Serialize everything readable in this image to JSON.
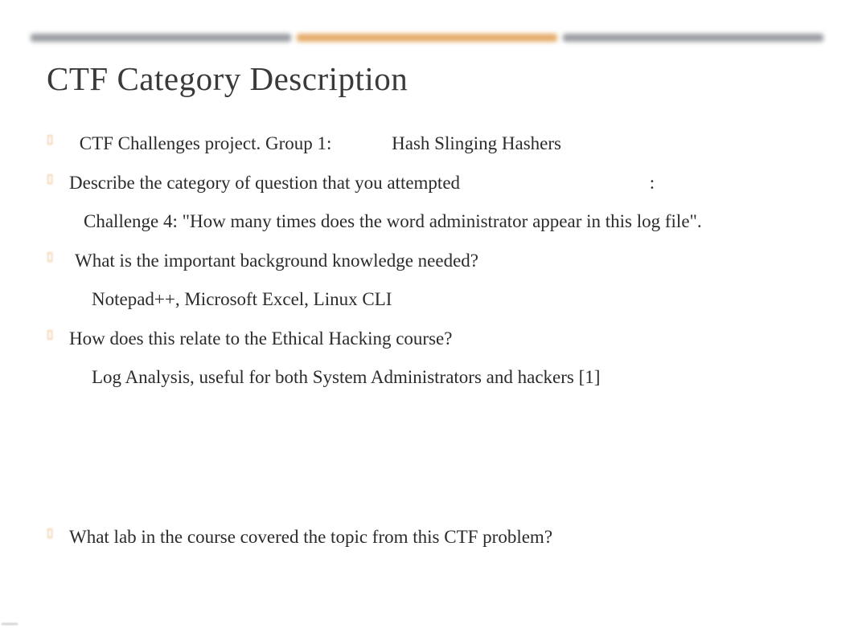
{
  "title": "CTF Category Description",
  "items": {
    "row1": " CTF Challenges project. Group 1:             Hash Slinging Hashers",
    "row2": "Describe the category of question that you attempted                                         :",
    "sub1": "Challenge 4: \"How many times does the word administrator appear in this log file\".",
    "row3": " What is the important background knowledge needed?",
    "sub2": "Notepad++, Microsoft Excel, Linux CLI",
    "row4": "How does this relate to the Ethical Hacking course?",
    "sub3": "Log Analysis, useful for both System Administrators and hackers [1]",
    "row5": "What lab in the course covered the topic from this CTF problem?"
  },
  "bullet_glyph": "▯"
}
